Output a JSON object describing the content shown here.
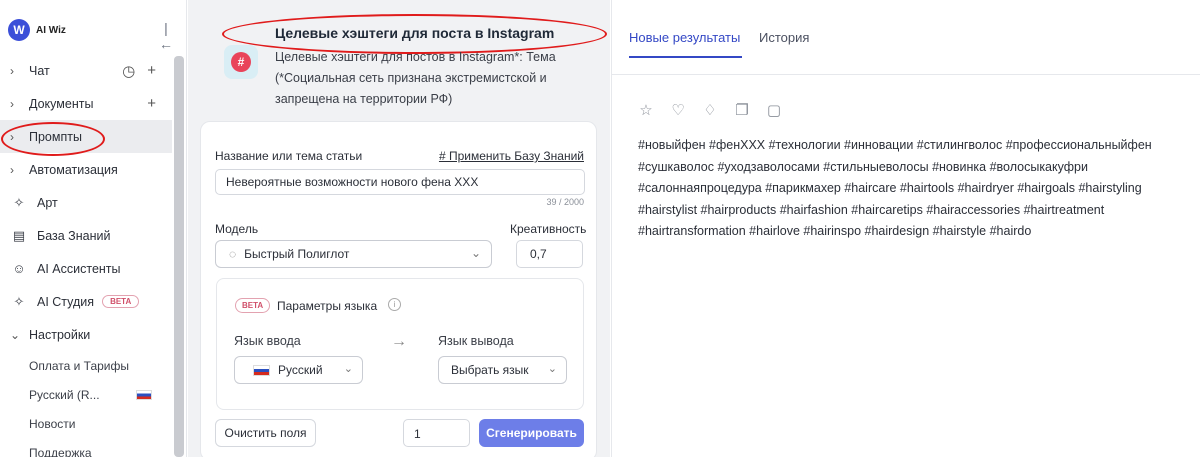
{
  "app": {
    "logo_text": "AI Wiz",
    "logo_letter": "W"
  },
  "sidebar": {
    "items": [
      {
        "label": "Чат"
      },
      {
        "label": "Документы"
      },
      {
        "label": "Промпты"
      },
      {
        "label": "Автоматизация"
      },
      {
        "label": "Арт"
      },
      {
        "label": "База Знаний"
      },
      {
        "label": "AI Ассистенты"
      },
      {
        "label": "AI Студия",
        "badge": "BETA"
      },
      {
        "label": "Настройки"
      }
    ],
    "sub_items": [
      {
        "label": "Оплата и Тарифы"
      },
      {
        "label": "Русский (R..."
      },
      {
        "label": "Новости"
      },
      {
        "label": "Поддержка"
      }
    ]
  },
  "prompt": {
    "title": "Целевые хэштеги для поста в Instagram",
    "description": "Целевые хэштеги для постов в Instagram*: Тема (*Социальная сеть признана экстремистской и запрещена на территории РФ)"
  },
  "form": {
    "topic_label": "Название или тема статьи",
    "apply_kb": "# Применить Базу Знаний",
    "topic_value": "Невероятные возможности нового фена XXX",
    "char_count": "39 / 2000",
    "model_label": "Модель",
    "model_value": "Быстрый Полиглот",
    "creativity_label": "Креативность",
    "creativity_value": "0,7",
    "lang": {
      "badge": "BETA",
      "title": "Параметры языка",
      "input_label": "Язык ввода",
      "output_label": "Язык вывода",
      "input_value": "Русский",
      "output_value": "Выбрать язык"
    },
    "clear_button": "Очистить поля",
    "count_value": "1",
    "generate_button": "Сгенерировать"
  },
  "results": {
    "tabs": [
      {
        "label": "Новые результаты"
      },
      {
        "label": "История"
      }
    ],
    "text": "#новыйфен #фенXXX #технологии #инновации #стилингволос #профессиональныйфен #сушкаволос #уходзаволосами #стильныеволосы #новинка #волосыкакуфри #салоннаяпроцедура #парикмахер #haircare #hairtools #hairdryer #hairgoals #hairstyling #hairstylist #hairproducts #hairfashion #haircaretips #hairaccessories #hairtreatment #hairtransformation #hairlove #hairinspo #hairdesign #hairstyle #hairdo"
  },
  "colors": {
    "accent": "#3448c5",
    "generate": "#6d7ee8",
    "annotation": "#e01b1b"
  }
}
